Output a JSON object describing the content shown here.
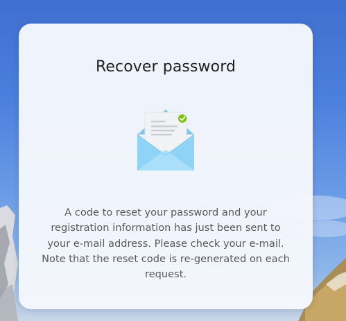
{
  "dialog": {
    "title": "Recover password",
    "illustration_icon": "envelope-with-check-icon",
    "message": "A code to reset your password and your registration information has just been sent to your e-mail address. Please check your e-mail. Note that the reset code is re-generated on each request."
  },
  "colors": {
    "card_background": "#f5f7fc",
    "title_text": "#1f1f1f",
    "body_text": "#5a5a5a",
    "envelope_blue": "#8fd3f7",
    "check_green": "#7cc40f"
  }
}
